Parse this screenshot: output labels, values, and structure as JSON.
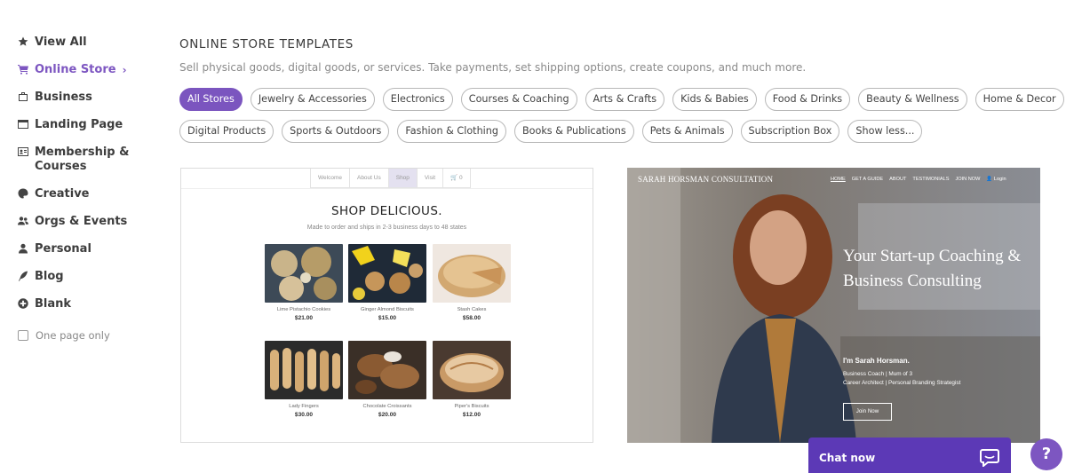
{
  "sidebar": {
    "items": [
      {
        "label": "View All",
        "icon": "star-icon"
      },
      {
        "label": "Online Store",
        "icon": "cart-icon"
      },
      {
        "label": "Business",
        "icon": "briefcase-icon"
      },
      {
        "label": "Landing Page",
        "icon": "window-icon"
      },
      {
        "label": "Membership & Courses",
        "icon": "id-card-icon"
      },
      {
        "label": "Creative",
        "icon": "palette-icon"
      },
      {
        "label": "Orgs & Events",
        "icon": "users-icon"
      },
      {
        "label": "Personal",
        "icon": "user-icon"
      },
      {
        "label": "Blog",
        "icon": "feather-icon"
      },
      {
        "label": "Blank",
        "icon": "plus-circle-icon"
      }
    ],
    "active_item": "Online Store",
    "active_chevron": "›",
    "one_page_only": "One page only"
  },
  "main": {
    "heading": "ONLINE STORE TEMPLATES",
    "subheading": "Sell physical goods, digital goods, or services. Take payments, set shipping options, create coupons, and much more.",
    "chips_row1": [
      "All Stores",
      "Jewelry & Accessories",
      "Electronics",
      "Courses & Coaching",
      "Arts & Crafts",
      "Kids & Babies",
      "Food & Drinks",
      "Beauty & Wellness",
      "Home & Decor"
    ],
    "chips_row2": [
      "Digital Products",
      "Sports & Outdoors",
      "Fashion & Clothing",
      "Books & Publications",
      "Pets & Animals",
      "Subscription Box",
      "Show less..."
    ],
    "active_chip": "All Stores"
  },
  "template1": {
    "nav": [
      "Welcome",
      "About Us",
      "Shop",
      "Visit",
      "🛒 0"
    ],
    "title": "SHOP DELICIOUS.",
    "subtitle": "Made to order and ships in 2-3 business days to 48 states",
    "products": [
      {
        "name": "Lime Pistachio Cookies",
        "price": "$21.00"
      },
      {
        "name": "Ginger Almond Biscuits",
        "price": "$15.00"
      },
      {
        "name": "Stash Cakes",
        "price": "$58.00"
      },
      {
        "name": "Lady Fingers",
        "price": "$30.00"
      },
      {
        "name": "Chocolate Croissants",
        "price": "$20.00"
      },
      {
        "name": "Piper's Biscuits",
        "price": "$12.00"
      }
    ]
  },
  "template2": {
    "brand": "SARAH HORSMAN CONSULTATION",
    "nav": [
      "HOME",
      "GET A GUIDE",
      "ABOUT",
      "TESTIMONIALS",
      "JOIN NOW",
      "👤 Login"
    ],
    "hero": "Your Start-up Coaching & Business Consulting",
    "name": "I'm Sarah Horsman.",
    "desc1": "Business Coach | Mum of 3",
    "desc2": "Career Architect | Personal Branding Strategist",
    "button": "Join Now"
  },
  "chat": {
    "label": "Chat now"
  },
  "help": {
    "label": "?"
  },
  "colors": {
    "accent": "#7d56c1",
    "chat": "#5c39b6"
  }
}
